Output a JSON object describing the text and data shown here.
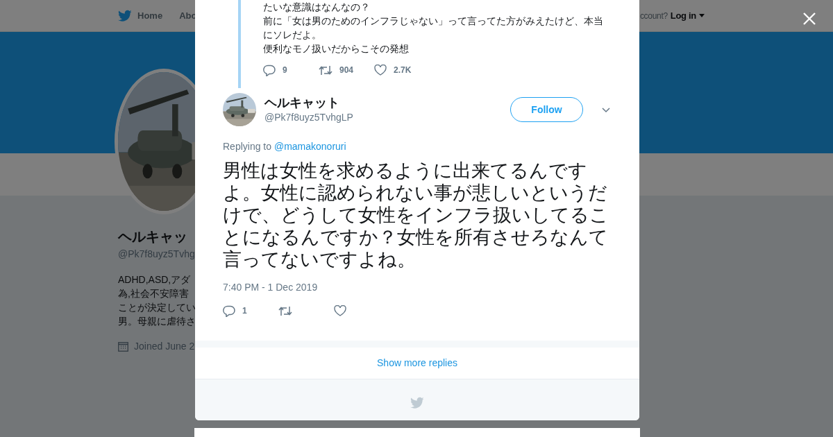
{
  "background": {
    "nav": {
      "items": [
        {
          "label": "Home",
          "kind": "home"
        },
        {
          "label": "Abo",
          "kind": "plain"
        }
      ],
      "login_prompt": "ccount?",
      "login": "Log in"
    },
    "profile": {
      "name": "ヘルキャッ",
      "handle": "@Pk7f8uyz5Tvhg",
      "bio": [
        "ADHD,ASD,アダ",
        "為,社会不安障害",
        "ことが決定してい",
        "男。母親に虐待さ"
      ],
      "joined": "Joined June 2"
    }
  },
  "parent_tweet": {
    "lines": [
      "たいな意識はなんなの？",
      "前に「女は男のためのインフラじゃない」って言ってた方がみえたけど、本当にソレだよ。",
      "便利なモノ扱いだからこその発想"
    ],
    "actions": [
      {
        "kind": "reply",
        "count": "9"
      },
      {
        "kind": "retweet",
        "count": "904"
      },
      {
        "kind": "like",
        "count": "2.7K"
      }
    ]
  },
  "tweet": {
    "name": "ヘルキャット",
    "handle": "@Pk7f8uyz5TvhgLP",
    "follow": "Follow",
    "replying_label": "Replying to",
    "replying_to": "@mamakonoruri",
    "text": "男性は女性を求めるように出来てるんですよ。女性に認められない事が悲しいというだけで、どうして女性をインフラ扱いしてることになるんですか？女性を所有させろなんて言ってないですよね。",
    "time": "7:40 PM - 1 Dec 2019",
    "actions": [
      {
        "kind": "reply",
        "count": "1"
      },
      {
        "kind": "retweet"
      },
      {
        "kind": "like"
      }
    ]
  },
  "show_more": "Show more replies"
}
